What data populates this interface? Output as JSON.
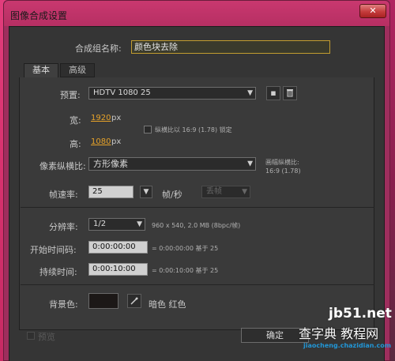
{
  "dialog": {
    "title": "图像合成设置",
    "close_glyph": "✕"
  },
  "comp_name": {
    "label": "合成组名称:",
    "value": "颜色块去除"
  },
  "tabs": [
    {
      "label": "基本",
      "active": true
    },
    {
      "label": "高级",
      "active": false
    }
  ],
  "preset": {
    "label": "预置:",
    "value": "HDTV 1080 25"
  },
  "width": {
    "label": "宽:",
    "value": "1920",
    "unit": "px"
  },
  "height": {
    "label": "高:",
    "value": "1080",
    "unit": "px"
  },
  "lock_ratio": {
    "label": "纵横比以 16:9 (1.78) 锁定",
    "checked": false
  },
  "pixel_aspect": {
    "label": "像素纵横比:",
    "value": "方形像素",
    "frame_aspect_label": "画幅纵横比:",
    "frame_aspect_value": "16:9 (1.78)"
  },
  "frame_rate": {
    "label": "帧速率:",
    "value": "25",
    "unit": "帧/秒",
    "drop_frame": "丢帧"
  },
  "resolution": {
    "label": "分辨率:",
    "value": "1/2",
    "info": "960 x 540, 2.0 MB (8bpc/帧)"
  },
  "start_timecode": {
    "label": "开始时间码:",
    "value": "0:00:00:00",
    "info": "= 0:00:00:00  基于 25"
  },
  "duration": {
    "label": "持续时间:",
    "value": "0:00:10:00",
    "info": "= 0:00:10:00  基于 25"
  },
  "background": {
    "label": "背景色:",
    "color": "#1c1817",
    "name": "暗色 红色"
  },
  "preview": {
    "label": "预览",
    "checked": false
  },
  "ok_button": "确定",
  "icons": {
    "preset_save": "save-preset-icon",
    "preset_delete": "delete-preset-icon",
    "eyedropper": "eyedropper-icon"
  },
  "watermark": {
    "site": "jb51.net",
    "text": "查字典 教程网",
    "url": "jiaocheng.chazidian.com"
  },
  "colors": {
    "accent_orange": "#e6a229",
    "name_border": "#c29c2f",
    "title_bar": "#b62f63"
  }
}
